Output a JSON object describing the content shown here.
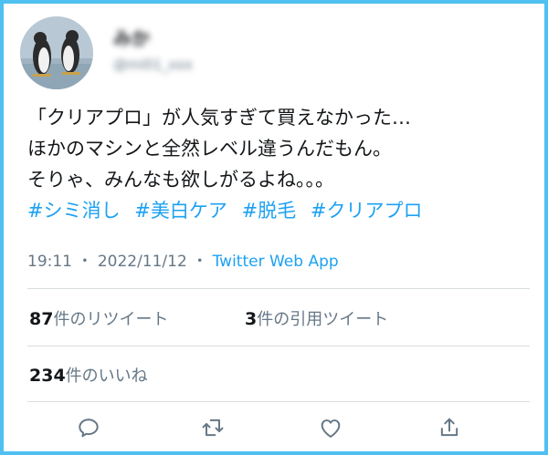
{
  "profile": {
    "display_name": "みか",
    "handle": "@mi01_xxx",
    "avatar_icon": "penguins-avatar"
  },
  "tweet": {
    "lines": [
      "「クリアプロ」が人気すぎて買えなかった…",
      "ほかのマシンと全然レベル違うんだもん。",
      "そりゃ、みんなも欲しがるよね。。。"
    ],
    "hashtags": [
      "#シミ消し",
      "#美白ケア",
      "#脱毛",
      "#クリアプロ"
    ]
  },
  "meta": {
    "time": "19:11",
    "separator": "・",
    "date": "2022/11/12",
    "source": "Twitter Web App"
  },
  "stats": {
    "retweets_count": "87",
    "retweets_label": "件のリツイート",
    "quotes_count": "3",
    "quotes_label": "件の引用ツイート",
    "likes_count": "234",
    "likes_label": "件のいいね"
  },
  "actions": [
    {
      "name": "reply-icon"
    },
    {
      "name": "retweet-icon"
    },
    {
      "name": "like-icon"
    },
    {
      "name": "share-icon"
    }
  ],
  "colors": {
    "frame_border": "#4fc0f0",
    "link": "#1da1f2",
    "text": "#14171a",
    "secondary_text": "#657786",
    "icon": "#657786"
  }
}
